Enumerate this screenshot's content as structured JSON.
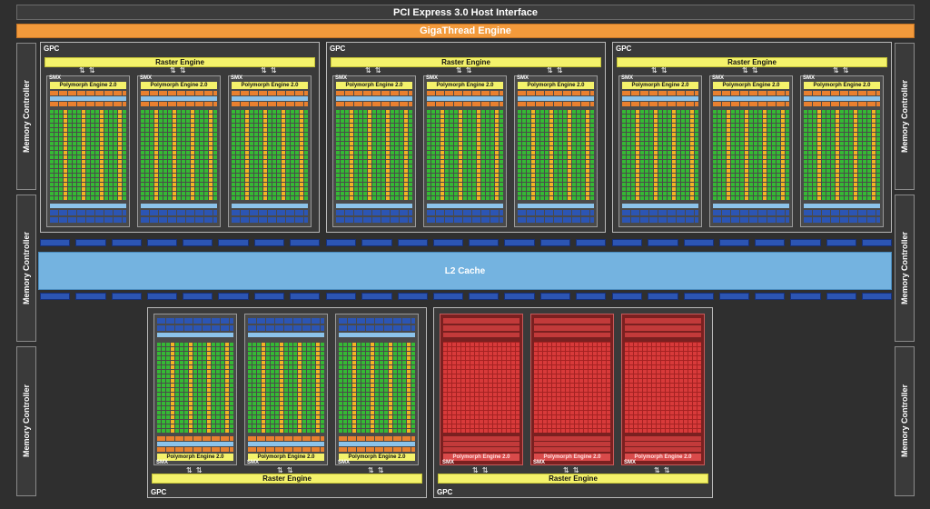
{
  "header": {
    "pcie_label": "PCI Express 3.0 Host Interface",
    "gigathread_label": "GigaThread Engine"
  },
  "memory_controller_label": "Memory Controller",
  "memory_controllers": [
    "Memory Controller",
    "Memory Controller",
    "Memory Controller",
    "Memory Controller",
    "Memory Controller",
    "Memory Controller"
  ],
  "l2_cache_label": "L2 Cache",
  "gpc_label": "GPC",
  "raster_engine_label": "Raster Engine",
  "smx_label": "SMX",
  "polymorph_label": "Polymorph Engine 2.0",
  "arrows_glyph": "⇅ ⇅",
  "gpcs": [
    {
      "state": "enabled"
    },
    {
      "state": "enabled"
    },
    {
      "state": "enabled"
    },
    {
      "state": "enabled"
    },
    {
      "state": "disabled"
    }
  ],
  "colors": {
    "disabled": "#c83232",
    "cuda_core": "#35b934",
    "special_unit": "#f3b324",
    "l2": "#74b3e0",
    "gigathread": "#f39a3b",
    "raster": "#f4f26b"
  }
}
